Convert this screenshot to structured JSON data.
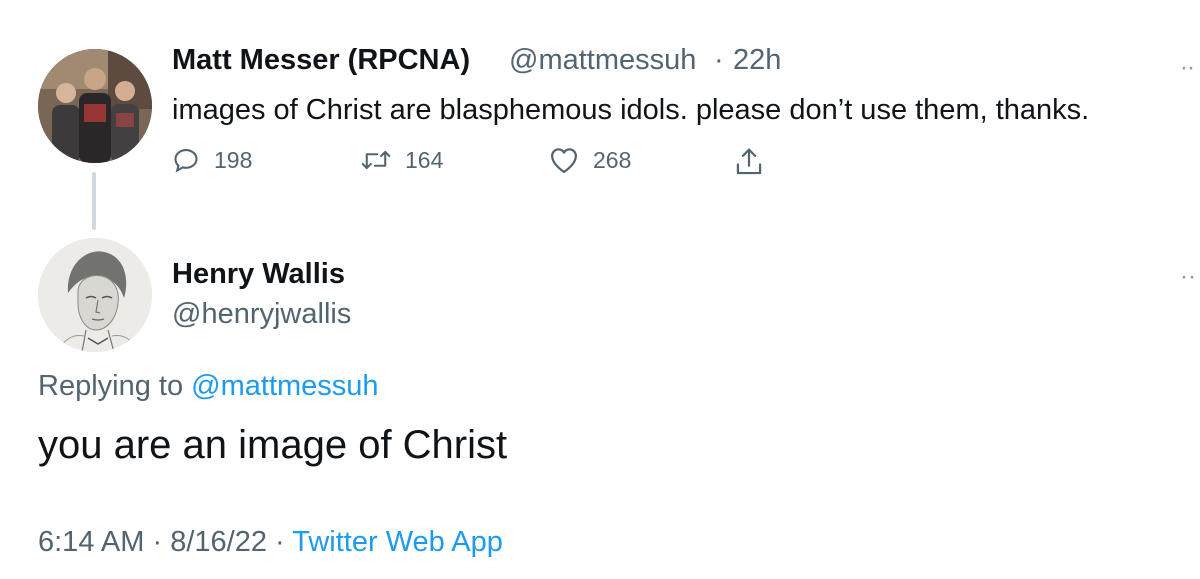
{
  "parent_tweet": {
    "author_name": "Matt Messer (RPCNA)",
    "author_handle": "@mattmessuh",
    "separator": "·",
    "time": "22h",
    "text": "images of Christ are blasphemous idols. please don’t use them, thanks.",
    "more_icon": "more-dots-icon",
    "actions": {
      "reply_count": "198",
      "retweet_count": "164",
      "like_count": "268"
    },
    "icons": [
      "reply-icon",
      "retweet-icon",
      "like-icon",
      "share-icon"
    ]
  },
  "reply_tweet": {
    "author_name": "Henry Wallis",
    "author_handle": "@henryjwallis",
    "replying_prefix": "Replying to",
    "replying_to": "@mattmessuh",
    "text": "you are an image of Christ",
    "time": "6:14 AM",
    "separator": "·",
    "date": "8/16/22",
    "source": "Twitter Web App"
  },
  "colors": {
    "text": "#0f1419",
    "secondary": "#536471",
    "link": "#1d9bf0",
    "thread_line": "#cfd9de"
  }
}
